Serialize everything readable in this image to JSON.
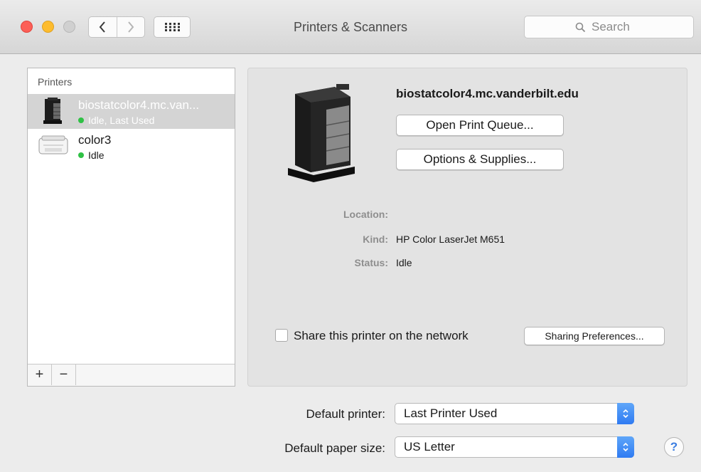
{
  "window": {
    "title": "Printers & Scanners",
    "search_placeholder": "Search",
    "icons": {
      "back": "chevron-left-icon",
      "forward": "chevron-right-icon",
      "grid": "grid-icon",
      "search": "magnifier-icon"
    }
  },
  "printers_list": {
    "header": "Printers",
    "items": [
      {
        "name": "biostatcolor4.mc.van...",
        "status": "Idle, Last Used",
        "selected": true,
        "status_color": "#2fc145"
      },
      {
        "name": "color3",
        "status": "Idle",
        "selected": false,
        "status_color": "#2fc145"
      }
    ],
    "add_label": "+",
    "remove_label": "−"
  },
  "details": {
    "device_name": "biostatcolor4.mc.vanderbilt.edu",
    "open_queue_label": "Open Print Queue...",
    "options_label": "Options & Supplies...",
    "location_label": "Location:",
    "location_value": "",
    "kind_label": "Kind:",
    "kind_value": "HP Color LaserJet M651",
    "status_label": "Status:",
    "status_value": "Idle",
    "share_label": "Share this printer on the network",
    "share_checked": false,
    "sharing_prefs_label": "Sharing Preferences..."
  },
  "defaults": {
    "printer_label": "Default printer:",
    "printer_value": "Last Printer Used",
    "paper_label": "Default paper size:",
    "paper_value": "US Letter"
  },
  "help_label": "?",
  "colors": {
    "accent": "#3a84f5",
    "status_dot": "#2fc145",
    "selection": "#d4d4d4"
  }
}
